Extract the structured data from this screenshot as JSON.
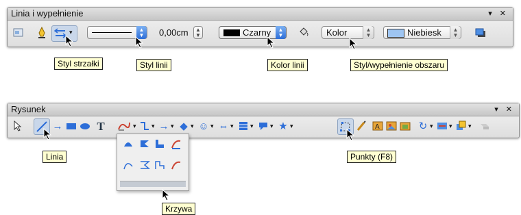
{
  "toolbar1": {
    "title": "Linia i wypełnienie",
    "controls": "▾ ✕",
    "icons": [
      "format-icon",
      "line-icon",
      "arrow-style-icon",
      "fill-bucket-icon",
      "shadow-icon"
    ],
    "line_width": "0,00cm",
    "line_color": "Czarny",
    "area_style": "Kolor",
    "area_fill": "Niebiesk",
    "colors": {
      "black": "#000000",
      "blue": "#9ec5f2",
      "accent": "#2d6ed8"
    }
  },
  "tooltips1": {
    "arrow_style": "Styl strzałki",
    "line_style": "Styl linii",
    "line_color": "Kolor linii",
    "area_style": "Styl/wypełnienie obszaru"
  },
  "toolbar2": {
    "title": "Rysunek",
    "controls": "▾ ✕",
    "text_tool": "T"
  },
  "tooltips2": {
    "line": "Linia",
    "points": "Punkty (F8)",
    "curve": "Krzywa"
  }
}
